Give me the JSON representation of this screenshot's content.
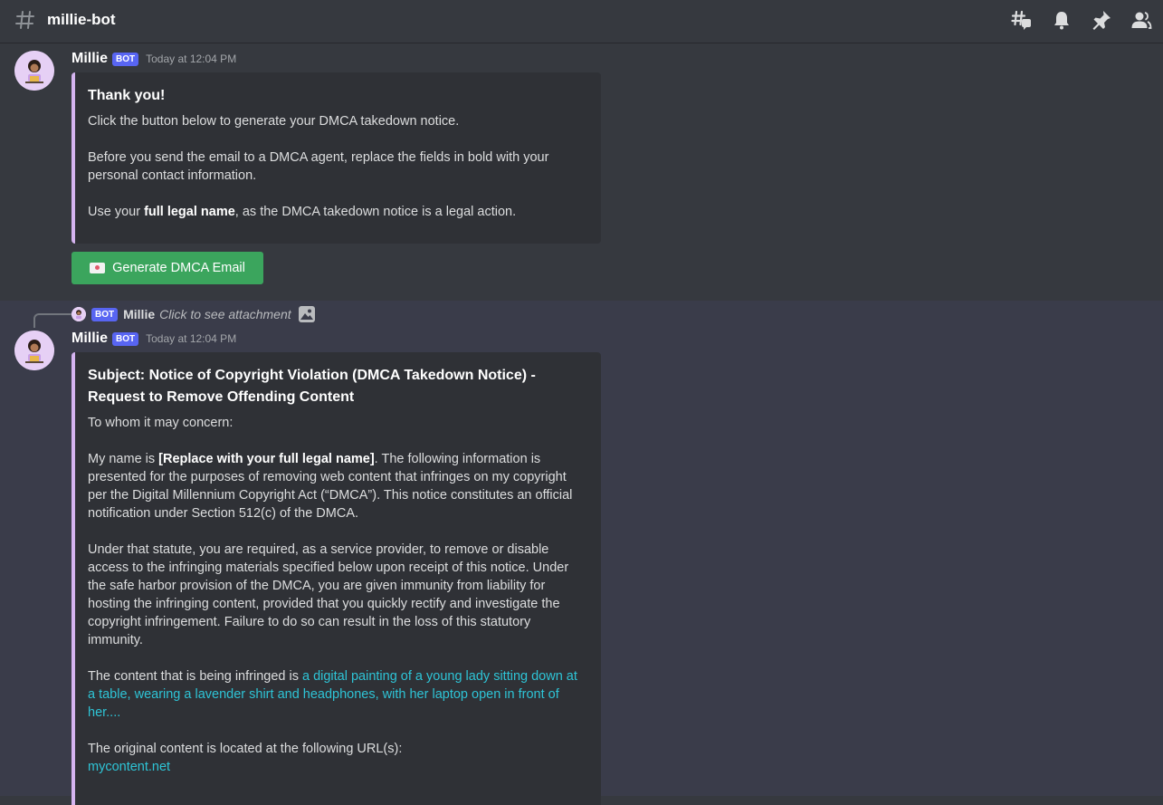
{
  "channel": {
    "name": "millie-bot"
  },
  "message1": {
    "author": "Millie",
    "bot_tag": "BOT",
    "timestamp": "Today at 12:04 PM",
    "embed": {
      "title": "Thank you!",
      "p1": "Click the button below to generate your DMCA takedown notice.",
      "p2": "Before you send the email to a DMCA agent, replace the fields in bold with your personal contact information.",
      "p3_before": "Use your ",
      "p3_bold": "full legal name",
      "p3_after": ", as the DMCA takedown notice is a legal action."
    },
    "button_label": "Generate DMCA Email"
  },
  "reply": {
    "bot_tag": "BOT",
    "author": "Millie",
    "text": "Click to see attachment"
  },
  "message2": {
    "author": "Millie",
    "bot_tag": "BOT",
    "timestamp": "Today at 12:04 PM",
    "embed": {
      "title": "Subject: Notice of Copyright Violation (DMCA Takedown Notice) - Request to Remove Offending Content",
      "greeting": "To whom it may concern:",
      "p1_before": "My name is ",
      "p1_bold": "[Replace with your full legal name]",
      "p1_after": ". The following information is presented for the purposes of removing web content that infringes on my copyright per the Digital Millennium Copyright Act (“DMCA”). This notice constitutes an official notification under Section 512(c) of the DMCA.",
      "p2": "Under that statute, you are required, as a service provider, to remove or disable access to the infringing materials specified below upon receipt of this notice. Under the safe harbor provision of the DMCA, you are given immunity from liability for hosting the infringing content, provided that you quickly rectify and investigate the copyright infringement. Failure to do so can result in the loss of this statutory immunity.",
      "p3_before": "The content that is being infringed is ",
      "p3_link": "a digital painting of a young lady sitting down at a table, wearing a lavender shirt and headphones, with her laptop open in front of her....",
      "p4": "The original content is located at the following URL(s):",
      "p4_link": "mycontent.net"
    }
  },
  "colors": {
    "background": "#36393f",
    "embed_bg": "#2f3136",
    "embed_accent": "#d5b4f0",
    "bot_tag": "#5865f2",
    "button": "#3ba55d",
    "link": "#2ec4d6"
  }
}
